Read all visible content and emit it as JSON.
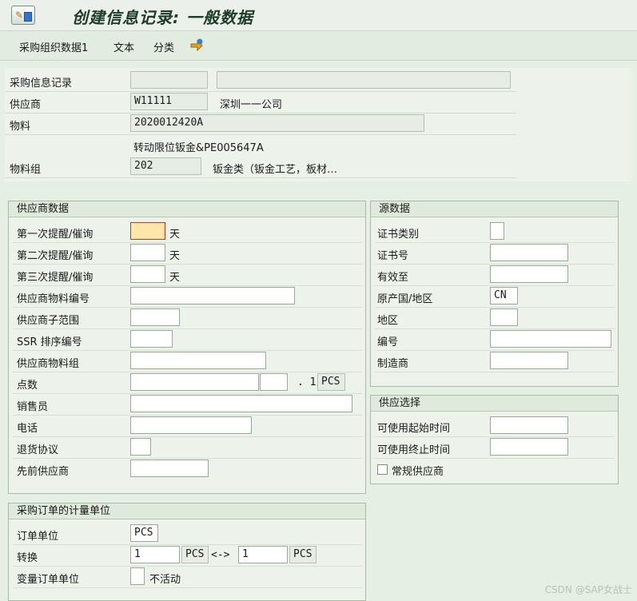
{
  "title": "创建信息记录: 一般数据",
  "toolbar": {
    "org_data": "采购组织数据1",
    "text": "文本",
    "classify": "分类",
    "nav_icon": "navigation-arrows-icon"
  },
  "header": {
    "info_record_label": "采购信息记录",
    "info_record_value": "",
    "info_record_desc": "",
    "vendor_label": "供应商",
    "vendor_value": "W11111",
    "vendor_name": "深圳一一公司",
    "material_label": "物料",
    "material_value": "2020012420A",
    "material_desc": "转动限位钣金&PE005647A",
    "matgroup_label": "物料组",
    "matgroup_value": "202",
    "matgroup_desc": "钣金类（钣金工艺，板材…"
  },
  "vendor_data": {
    "title": "供应商数据",
    "reminder1_label": "第一次提醒/催询",
    "reminder2_label": "第二次提醒/催询",
    "reminder3_label": "第三次提醒/催询",
    "reminder1_value": "",
    "reminder2_value": "",
    "reminder3_value": "",
    "day_unit": "天",
    "vendor_mat_no_label": "供应商物料编号",
    "vendor_subrange_label": "供应商子范围",
    "ssr_label": "SSR 排序编号",
    "vendor_matgroup_label": "供应商物料组",
    "points_label": "点数",
    "points_per": ". 1",
    "points_unit": "PCS",
    "salesperson_label": "销售员",
    "phone_label": "电话",
    "return_label": "退货协议",
    "prior_vendor_label": "先前供应商"
  },
  "source_data": {
    "title": "源数据",
    "cert_type_label": "证书类别",
    "cert_no_label": "证书号",
    "valid_to_label": "有效至",
    "country_label": "原产国/地区",
    "country_value": "CN",
    "region_label": "地区",
    "number_label": "编号",
    "manufacturer_label": "制造商"
  },
  "supply": {
    "title": "供应选择",
    "avail_from_label": "可使用起始时间",
    "avail_to_label": "可使用终止时间",
    "regular_vendor_label": "常规供应商"
  },
  "po_unit": {
    "title": "采购订单的计量单位",
    "order_unit_label": "订单单位",
    "order_unit_value": "PCS",
    "conversion_label": "转换",
    "conv_left_value": "1",
    "conv_left_unit": "PCS",
    "conv_arrow": "<->",
    "conv_right_value": "1",
    "conv_right_unit": "PCS",
    "var_unit_label": "变量订单单位",
    "var_unit_status": "不活动"
  },
  "watermark": "CSDN @SAP女战士"
}
